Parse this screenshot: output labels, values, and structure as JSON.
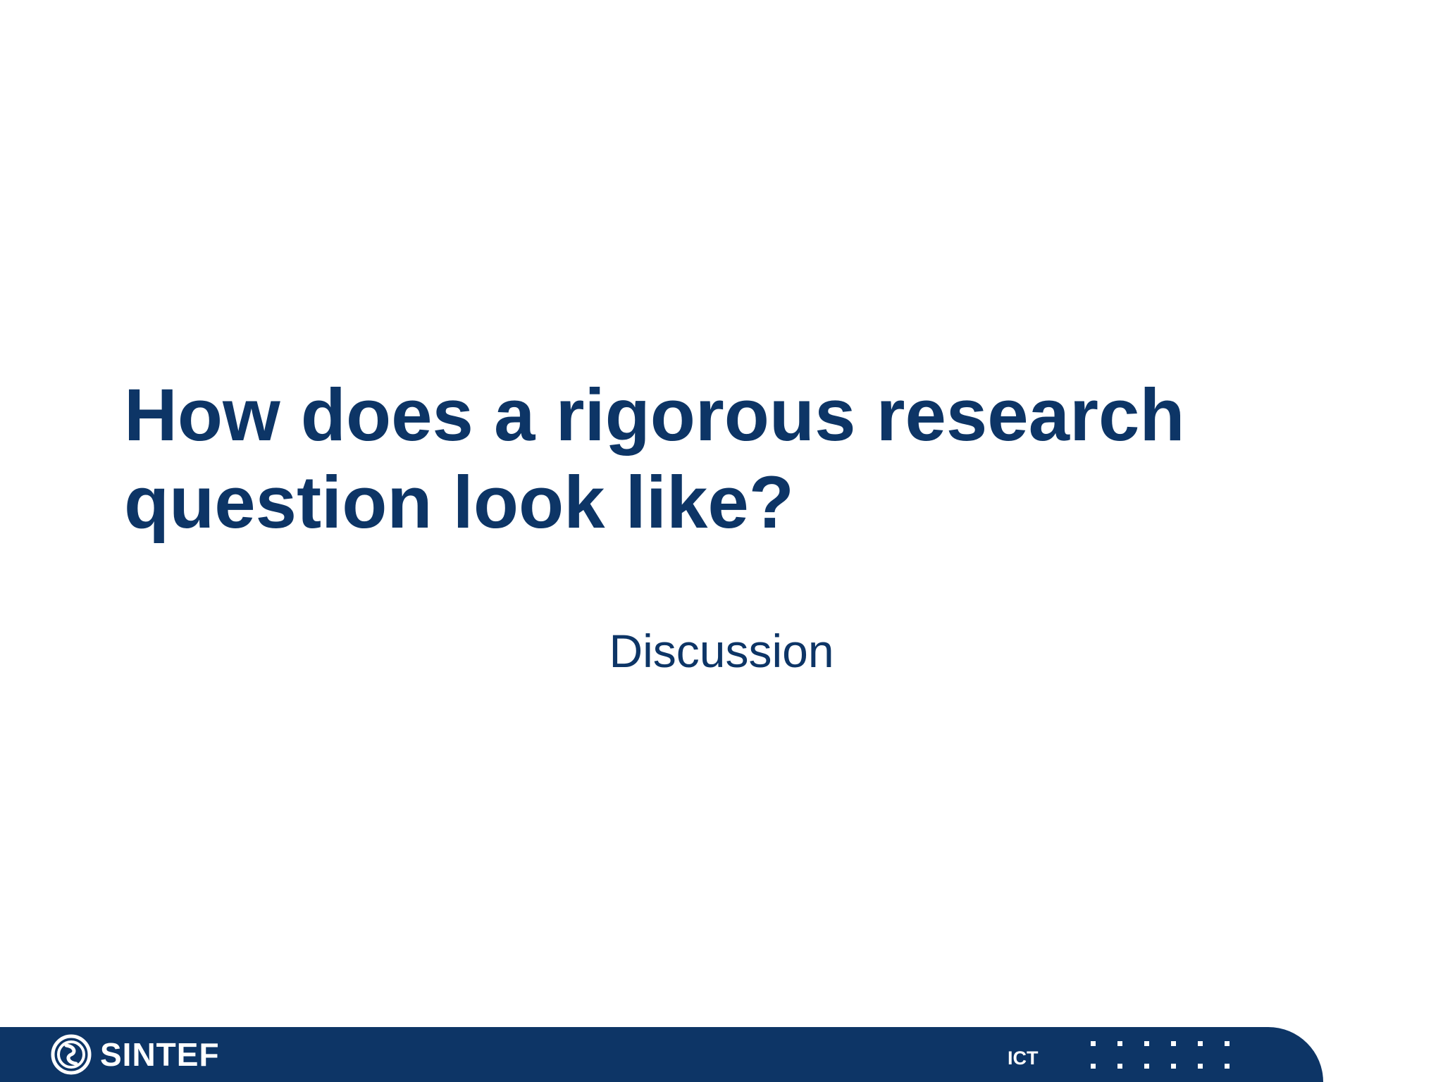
{
  "slide": {
    "title_line1": "How does a rigorous research",
    "title_line2": "question look like?",
    "subtitle": "Discussion"
  },
  "footer": {
    "logo_text": "SINTEF",
    "unit_label": "ICT",
    "logo_icon": "sintef-logo-icon",
    "dots_icon": "dot-grid-icon"
  },
  "colors": {
    "brand_navy": "#0d3566",
    "background": "#ffffff",
    "footer_text": "#ffffff"
  }
}
